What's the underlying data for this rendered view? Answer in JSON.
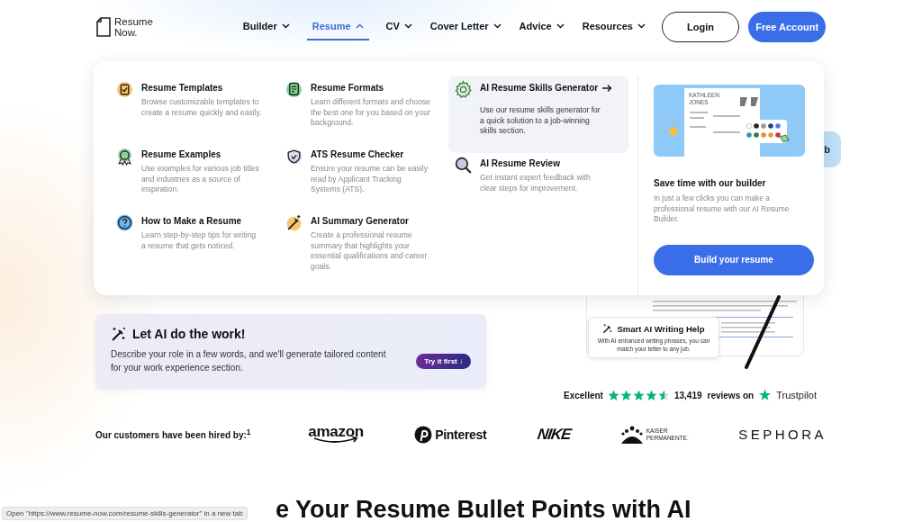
{
  "header": {
    "logo": {
      "line1": "Resume",
      "line2": "Now."
    },
    "nav": [
      {
        "label": "Builder",
        "selected": false,
        "expanded": false
      },
      {
        "label": "Resume",
        "selected": true,
        "expanded": true
      },
      {
        "label": "CV",
        "selected": false,
        "expanded": false
      },
      {
        "label": "Cover Letter",
        "selected": false,
        "expanded": false
      },
      {
        "label": "Advice",
        "selected": false,
        "expanded": false
      },
      {
        "label": "Resources",
        "selected": false,
        "expanded": false
      }
    ],
    "login": "Login",
    "cta": "Free Account"
  },
  "dropdown": {
    "columns": [
      {
        "items": [
          {
            "title": "Resume Templates",
            "description": "Browse customizable templates to create a resume quickly and easily.",
            "selected": false
          },
          {
            "title": "Resume Examples",
            "description": "Use examples for various job titles and industries as a source of inspiration.",
            "selected": false
          },
          {
            "title": "How to Make a Resume",
            "description": "Learn step-by-step tips for writing a resume that gets noticed.",
            "selected": false
          }
        ]
      },
      {
        "items": [
          {
            "title": "Resume Formats",
            "description": "Learn different formats and choose the best one for you based on your background.",
            "selected": false
          },
          {
            "title": "ATS Resume Checker",
            "description": "Ensure your resume can be easily read by Applicant Tracking Systems (ATS).",
            "selected": false
          },
          {
            "title": "AI Summary Generator",
            "description": "Create a professional resume summary that highlights your essential qualifications and career goals.",
            "selected": false
          }
        ]
      },
      {
        "items": [
          {
            "title": "AI Resume Skills Generator",
            "description": "Use our resume skills generator for a quick solution to a job-winning skills section.",
            "selected": true
          },
          {
            "title": "AI Resume Review",
            "description": "Get instant expert feedback with clear steps for improvement.",
            "selected": false
          }
        ]
      }
    ],
    "promo": {
      "illustration_name": "KATHLEEN JONES",
      "title": "Save time with our builder",
      "description": "In just a few clicks you can make a professional resume with our AI Resume Builder.",
      "button": "Build your resume"
    }
  },
  "side_badge": "b",
  "ai_card": {
    "title": "Let AI do the work!",
    "description": "Describe your role in a few words, and we'll generate tailored content for your work experience section.",
    "button": "Try it first ↓"
  },
  "writing_help": {
    "title": "Smart AI Writing Help",
    "description": "With AI enhanced writing phrases, you can match your letter to any job."
  },
  "rating": {
    "label": "Excellent",
    "stars": 4.5,
    "count": "13,419",
    "suffix": "reviews on",
    "brand": "Trustpilot"
  },
  "hired_by": {
    "label": "Our customers have been hired by:$^{1}$",
    "logos": [
      "amazon",
      "Pinterest",
      "NIKE",
      "KAISER PERMANENTE.",
      "SEPHORA"
    ]
  },
  "heading": "e Your Resume Bullet Points with AI",
  "status_bar": "Open \"https://www.resume-now.com/resume-skills-generator\" in a new tab"
}
